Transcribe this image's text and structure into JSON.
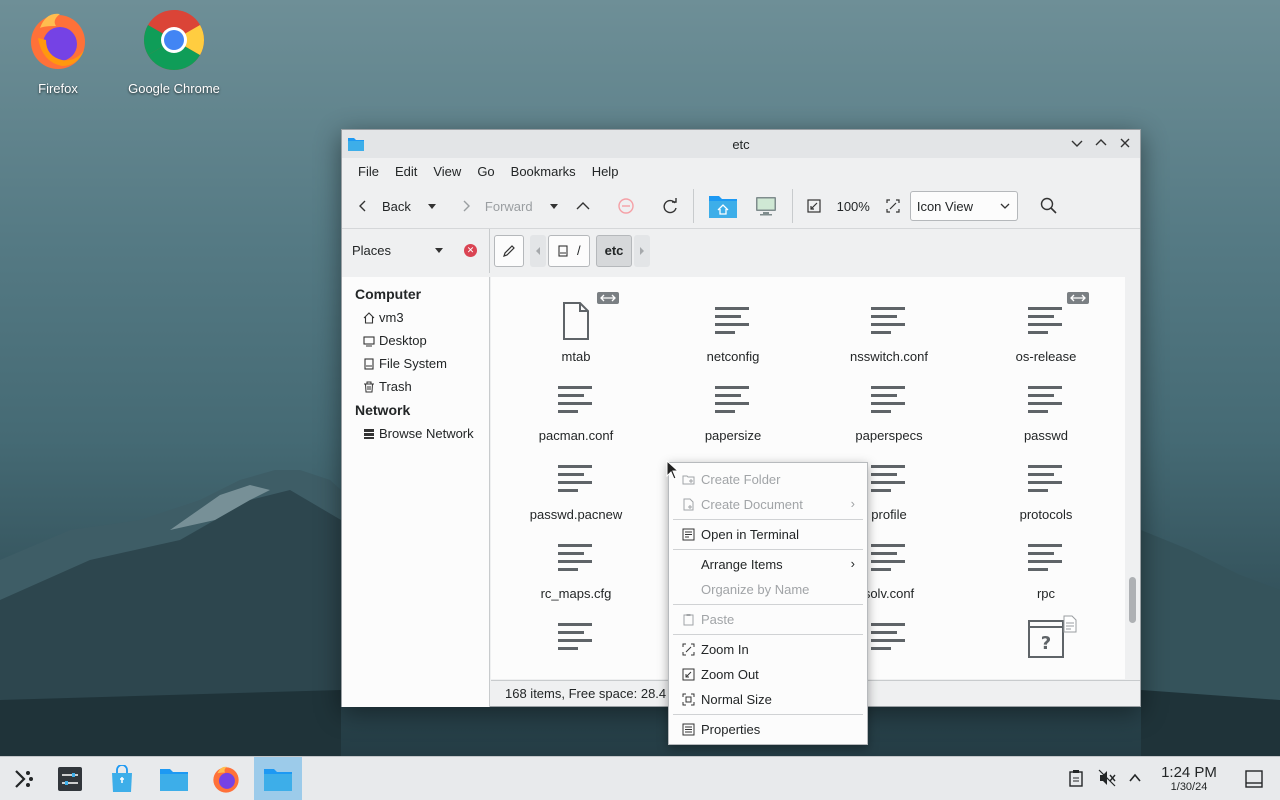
{
  "desktop": {
    "icons": [
      {
        "label": "Firefox"
      },
      {
        "label": "Google Chrome"
      }
    ]
  },
  "window": {
    "title": "etc",
    "menu": [
      "File",
      "Edit",
      "View",
      "Go",
      "Bookmarks",
      "Help"
    ],
    "toolbar": {
      "back": "Back",
      "forward": "Forward",
      "zoom": "100%",
      "view_mode": "Icon View"
    },
    "places_label": "Places",
    "path": {
      "root": "/",
      "current": "etc"
    },
    "sidebar": {
      "groups": [
        {
          "title": "Computer",
          "items": [
            "vm3",
            "Desktop",
            "File System",
            "Trash"
          ]
        },
        {
          "title": "Network",
          "items": [
            "Browse Network"
          ]
        }
      ]
    },
    "files": [
      {
        "name": "mtab",
        "type": "link-blank"
      },
      {
        "name": "netconfig",
        "type": "text"
      },
      {
        "name": "nsswitch.conf",
        "type": "text"
      },
      {
        "name": "os-release",
        "type": "link-text"
      },
      {
        "name": "pacman.conf",
        "type": "text"
      },
      {
        "name": "papersize",
        "type": "text"
      },
      {
        "name": "paperspecs",
        "type": "text"
      },
      {
        "name": "passwd",
        "type": "text"
      },
      {
        "name": "passwd.pacnew",
        "type": "text"
      },
      {
        "name": "",
        "type": "hidden"
      },
      {
        "name": "profile",
        "type": "text"
      },
      {
        "name": "protocols",
        "type": "text"
      },
      {
        "name": "rc_maps.cfg",
        "type": "text"
      },
      {
        "name": "",
        "type": "hidden"
      },
      {
        "name": "solv.conf",
        "type": "text"
      },
      {
        "name": "rpc",
        "type": "text"
      }
    ],
    "status": "168 items, Free space: 28.4"
  },
  "context_menu": {
    "items": [
      {
        "label": "Create Folder",
        "disabled": true
      },
      {
        "label": "Create Document",
        "disabled": true,
        "submenu": true
      },
      {
        "label": "Open in Terminal",
        "disabled": false
      },
      {
        "label": "Arrange Items",
        "disabled": false,
        "submenu": true
      },
      {
        "label": "Organize by Name",
        "disabled": true
      },
      {
        "label": "Paste",
        "disabled": true
      },
      {
        "label": "Zoom In",
        "disabled": false
      },
      {
        "label": "Zoom Out",
        "disabled": false
      },
      {
        "label": "Normal Size",
        "disabled": false
      },
      {
        "label": "Properties",
        "disabled": false
      }
    ]
  },
  "taskbar": {
    "time": "1:24 PM",
    "date": "1/30/24"
  },
  "colors": {
    "accent": "#3daee9",
    "active_task": "#9ccbea",
    "folder": "#1d99f3"
  }
}
